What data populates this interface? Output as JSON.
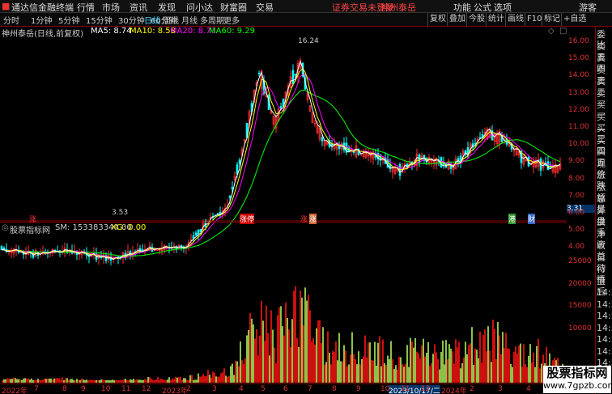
{
  "titlebar": {
    "app": "通达信金融终端",
    "menu": [
      "行情",
      "市场",
      "资讯",
      "发现",
      "问小达",
      "财富圈",
      "交易"
    ],
    "notice": "证券交易未登录",
    "stock": "神州泰岳",
    "right": [
      "功能",
      "公式",
      "选项"
    ],
    "guest": "游客"
  },
  "toolbar": {
    "periods": [
      "分时",
      "1分钟",
      "5分钟",
      "15分钟",
      "30分钟",
      "60分钟",
      "日线",
      "周线",
      "月线",
      "多周期",
      "更多"
    ],
    "right": [
      "复权",
      "叠加",
      "今股",
      "统计",
      "画线",
      "F10",
      "标记",
      "+自选"
    ]
  },
  "info": {
    "name": "神州泰岳(日线,前复权)",
    "ma5": "MA5: 8.74",
    "ma10": "MA10: 8.58",
    "ma20": "MA20: 8.73",
    "ma60": "MA60: 9.29"
  },
  "price_axis": [
    "16.00",
    "15.00",
    "14.00",
    "13.00",
    "12.00",
    "11.00",
    "10.00",
    "9.00",
    "8.00",
    "7.00",
    "6.00",
    "5.00",
    "4.00"
  ],
  "high_label": "16.24",
  "low_label": "3.53",
  "cur_price": "3.31",
  "tags": {
    "zt": "涨",
    "zt2": "涨停",
    "zhang": "涨",
    "gang": "港",
    "cai": "财"
  },
  "indicator": {
    "name": "股票指标网",
    "sm": "SM: 153383344.00",
    "xg": "XG: 0.00"
  },
  "vol_axis": [
    "25000",
    "20000",
    "15000",
    "10000"
  ],
  "right_panel": [
    "委比",
    "卖五",
    "卖四",
    "卖三",
    "卖二",
    "卖一",
    "买一",
    "买二",
    "买三",
    "买四",
    "买五",
    "现价",
    "涨跌",
    "涨幅",
    "总量",
    "外盘",
    "换手",
    "净资",
    "收益",
    "自动",
    "行情",
    "盘后",
    "14:56",
    "14:56",
    "14:56",
    "14:56",
    "14:56",
    "14:56",
    "14:56"
  ],
  "xaxis": [
    "2022年",
    "7",
    "8",
    "9",
    "10",
    "11",
    "12",
    "2023年",
    "2",
    "3",
    "4",
    "5",
    "6",
    "7",
    "8",
    "9",
    "10",
    "11",
    "12",
    "2024年",
    "2",
    "3",
    "4"
  ],
  "xaxis_sel": "2023/10/17/二",
  "watermark": {
    "line1": "股票指标网",
    "line2": "www.7gpzb.com"
  },
  "colors": {
    "up": "#ff3030",
    "down": "#00ffff",
    "ma5": "#ffffff",
    "ma10": "#ffff00",
    "ma20": "#ff00ff",
    "ma60": "#00ff00",
    "axis": "#d33"
  }
}
